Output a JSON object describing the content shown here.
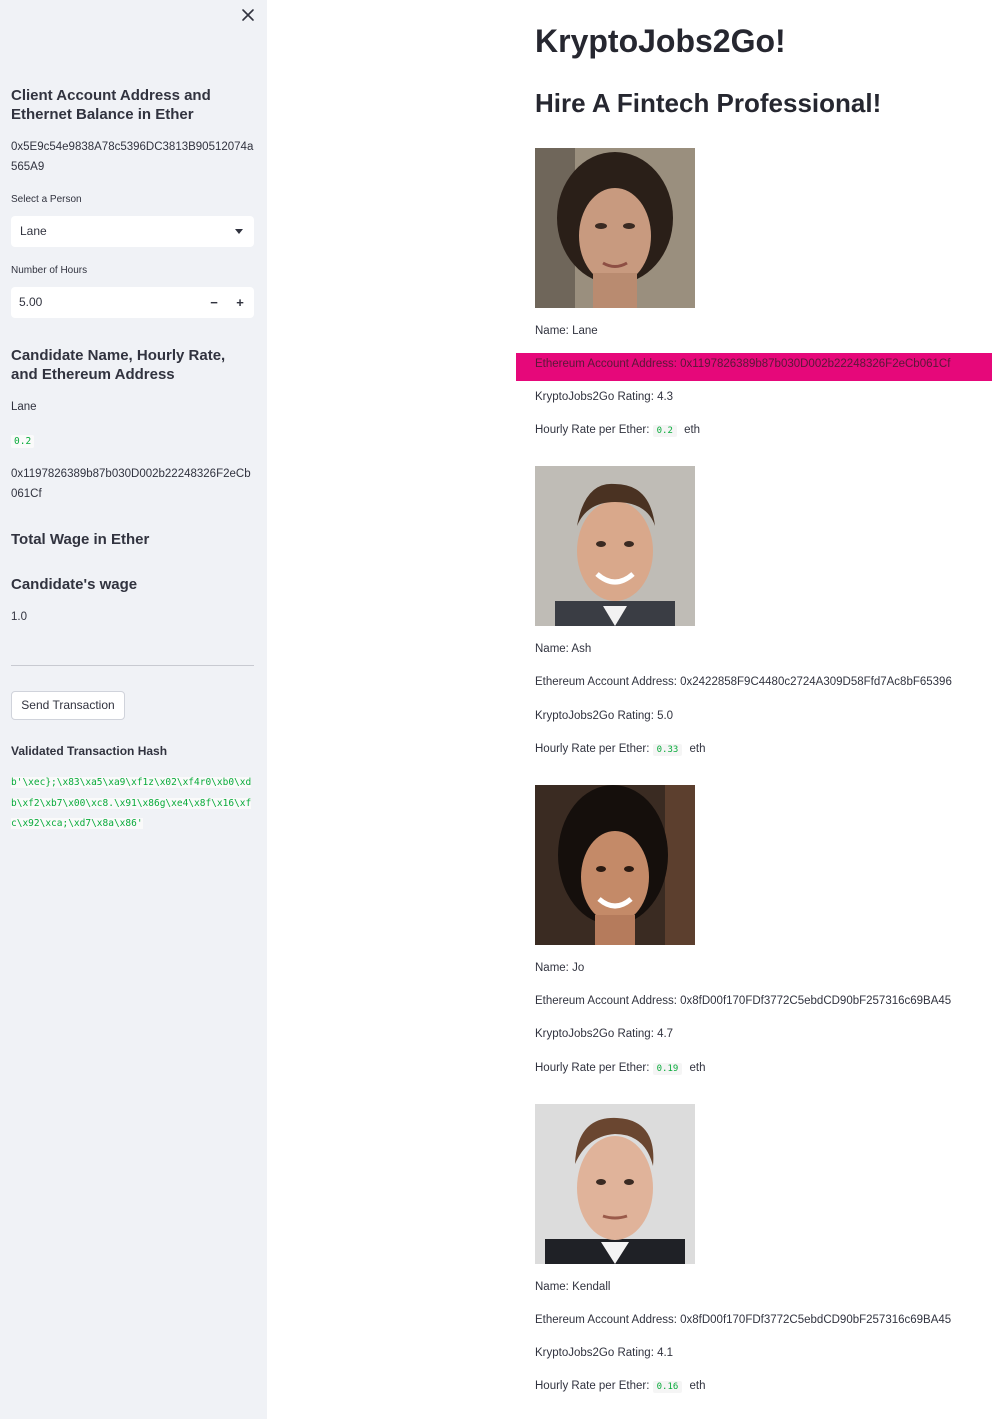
{
  "sidebar": {
    "account_header": "Client Account Address and Ethernet Balance in Ether",
    "account_address": "0x5E9c54e9838A78c5396DC3813B90512074a565A9",
    "select_label": "Select a Person",
    "select_value": "Lane",
    "hours_label": "Number of Hours",
    "hours_value": "5.00",
    "hours_minus": "−",
    "hours_plus": "+",
    "candidate_header": "Candidate Name, Hourly Rate, and Ethereum Address",
    "candidate_name": "Lane",
    "candidate_rate": "0.2",
    "candidate_address": "0x1197826389b87b030D002b22248326F2eCb061Cf",
    "total_wage_header": "Total Wage in Ether",
    "wage_header": "Candidate's wage",
    "wage_value": "1.0",
    "send_button": "Send Transaction",
    "hash_header": "Validated Transaction Hash",
    "hash_value": "b'\\xec};\\x83\\xa5\\xa9\\xf1z\\x02\\xf4r0\\xb0\\xdb\\xf2\\xb7\\x00\\xc8.\\x91\\x86g\\xe4\\x8f\\x16\\xfc\\x92\\xca;\\xd7\\x8a\\x86'"
  },
  "main": {
    "title": "KryptoJobs2Go!",
    "subtitle": "Hire A Fintech Professional!",
    "candidates": [
      {
        "name_line": "Name: Lane",
        "address_line": "Ethereum Account Address: 0x1197826389b87b030D002b22248326F2eCb061Cf",
        "rating_line": "KryptoJobs2Go Rating: 4.3",
        "rate_label": "Hourly Rate per Ether:",
        "rate": "0.2",
        "unit": "eth",
        "highlighted": true
      },
      {
        "name_line": "Name: Ash",
        "address_line": "Ethereum Account Address: 0x2422858F9C4480c2724A309D58Ffd7Ac8bF65396",
        "rating_line": "KryptoJobs2Go Rating: 5.0",
        "rate_label": "Hourly Rate per Ether:",
        "rate": "0.33",
        "unit": "eth",
        "highlighted": false
      },
      {
        "name_line": "Name: Jo",
        "address_line": "Ethereum Account Address: 0x8fD00f170FDf3772C5ebdCD90bF257316c69BA45",
        "rating_line": "KryptoJobs2Go Rating: 4.7",
        "rate_label": "Hourly Rate per Ether:",
        "rate": "0.19",
        "unit": "eth",
        "highlighted": false
      },
      {
        "name_line": "Name: Kendall",
        "address_line": "Ethereum Account Address: 0x8fD00f170FDf3772C5ebdCD90bF257316c69BA45",
        "rating_line": "KryptoJobs2Go Rating: 4.1",
        "rate_label": "Hourly Rate per Ether:",
        "rate": "0.16",
        "unit": "eth",
        "highlighted": false
      }
    ]
  },
  "colors": {
    "sidebar_bg": "#f0f2f6",
    "highlight": "#e6087a",
    "code_green": "#09ab3b"
  },
  "icons": [
    "close-icon",
    "chevron-down-icon",
    "minus-icon",
    "plus-icon"
  ]
}
